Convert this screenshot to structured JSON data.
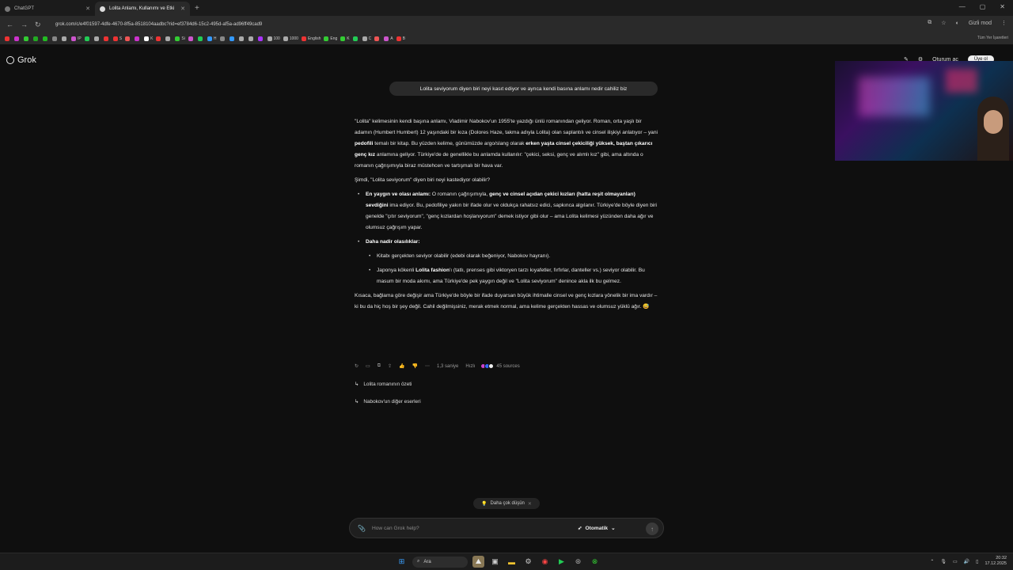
{
  "browser": {
    "tabs": [
      {
        "title": "ChatGPT",
        "active": false
      },
      {
        "title": "Lolita Anlamı, Kullanımı ve Etki",
        "active": true
      }
    ],
    "url": "grok.com/c/e4f01597-4dfe-4670-8f5a-8518104aadbc?rid=ef3784d6-15c2-495d-af5a-ad96ff49cad9",
    "profile": "Gizli mod",
    "bookmarks": [
      "IP",
      "S",
      "K",
      "Si",
      "H",
      "100",
      "1000",
      "English",
      "Eng",
      "K",
      "C",
      "A",
      "B"
    ],
    "bookmarks_right": "Tüm Yer İşaretleri"
  },
  "app": {
    "name": "Grok",
    "top_right": {
      "login": "Oturum aç",
      "signup": "Üye ol"
    }
  },
  "conversation": {
    "user_message": "Lolita seviyorum diyen biri neyi kasıt ediyor ve ayrıca kendi basına anlamı nedir cahiliz biz",
    "answer": {
      "p1": "\"Lolita\" kelimesinin kendi başına anlamı, Vladimir Nabokov'un 1955'te yazdığı ünlü romanından geliyor. Roman, orta yaşlı bir adamın (Humbert Humbert) 12 yaşındaki bir kıza (Dolores Haze, takma adıyla Lolita) olan saplantılı ve cinsel ilişkiyi anlatıyor – yani ",
      "p1_b1": "pedofili",
      "p1_mid": " temalı bir kitap. Bu yüzden kelime, günümüzde argo/slang olarak ",
      "p1_b2": "erken yaşta cinsel çekiciliği yüksek, baştan çıkarıcı genç kız",
      "p1_end": " anlamına geliyor. Türkiye'de de genellikle bu anlamda kullanılır: \"çekici, seksi, genç ve alımlı kız\" gibi, ama altında o romanın çağrışımıyla biraz müstehcen ve tartışmalı bir hava var.",
      "p2": "Şimdi, \"Lolita seviyorum\" diyen biri neyi kastediyor olabilir?",
      "li1_b": "En yaygın ve olası anlamı:",
      "li1_t1": " O romanın çağrışımıyla, ",
      "li1_b2": "genç ve cinsel açıdan çekici kızları (hatta reşit olmayanları) sevdiğini",
      "li1_t2": " ima ediyor. Bu, pedofiliye yakın bir ifade olur ve oldukça rahatsız edici, sapkınca algılanır. Türkiye'de böyle diyen biri genelde \"çıtır seviyorum\", \"genç kızlardan hoşlanıyorum\" demek istiyor gibi olur – ama Lolita kelimesi yüzünden daha ağır ve olumsuz çağrışım yapar.",
      "li2_b": "Daha nadir olasılıklar:",
      "sub1": "Kitabı gerçekten seviyor olabilir (edebi olarak beğeniyor, Nabokov hayranı).",
      "sub2_t1": "Japonya kökenli ",
      "sub2_b": "Lolita fashion",
      "sub2_t2": "'ı (tatlı, prenses gibi viktoryen tarzı kıyafetler, fırfırlar, danteller vs.) seviyor olabilir. Bu masum bir moda akımı, ama Türkiye'de pek yaygın değil ve \"Lolita seviyorum\" denince akla ilk bu gelmez.",
      "p3": "Kısaca, bağlama göre değişir ama Türkiye'de böyle bir ifade duyarsan büyük ihtimalle cinsel ve genç kızlara yönelik bir ima vardır – ki bu da hiç hoş bir şey değil. Cahil değilmişsiniz, merak etmek normal, ama kelime gerçekten hassas ve olumsuz yüklü ağır. 😅"
    },
    "meta": {
      "time": "1,3 saniye",
      "mode": "Hızlı",
      "sources": "45 sources"
    },
    "followups": [
      "Lolita romanının özeti",
      "Nabokov'un diğer eserleri"
    ]
  },
  "composer": {
    "think_more": "Daha çok düşün",
    "placeholder": "How can Grok help?",
    "mode": "Otomatik"
  },
  "taskbar": {
    "search": "Ara",
    "time": "20:32",
    "date": "17.12.2025"
  }
}
